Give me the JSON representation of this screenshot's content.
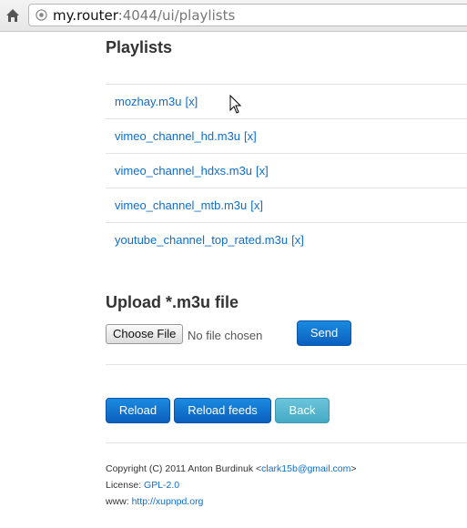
{
  "browser": {
    "url_host": "my.router",
    "url_rest": ":4044/ui/playlists"
  },
  "playlists": {
    "title": "Playlists",
    "remove_label": "[x]",
    "items": [
      {
        "name": "mozhay.m3u"
      },
      {
        "name": "vimeo_channel_hd.m3u"
      },
      {
        "name": "vimeo_channel_hdxs.m3u"
      },
      {
        "name": "vimeo_channel_mtb.m3u"
      },
      {
        "name": "youtube_channel_top_rated.m3u"
      }
    ]
  },
  "upload": {
    "title": "Upload *.m3u file",
    "choose_label": "Choose File",
    "no_file_label": "No file chosen",
    "send_label": "Send"
  },
  "actions": {
    "reload_label": "Reload",
    "reload_feeds_label": "Reload feeds",
    "back_label": "Back"
  },
  "footer": {
    "copyright": "Copyright (C) 2011 Anton Burdinuk <",
    "email": "clark15b@gmail.com",
    "copyright_end": ">",
    "license_label": "License: ",
    "license": "GPL-2.0",
    "www_label": "www: ",
    "www": "http://xupnpd.org"
  },
  "colors": {
    "link": "#0d6ecd",
    "primary_button": "#0a6fd0",
    "info_button": "#5bb8d2"
  }
}
